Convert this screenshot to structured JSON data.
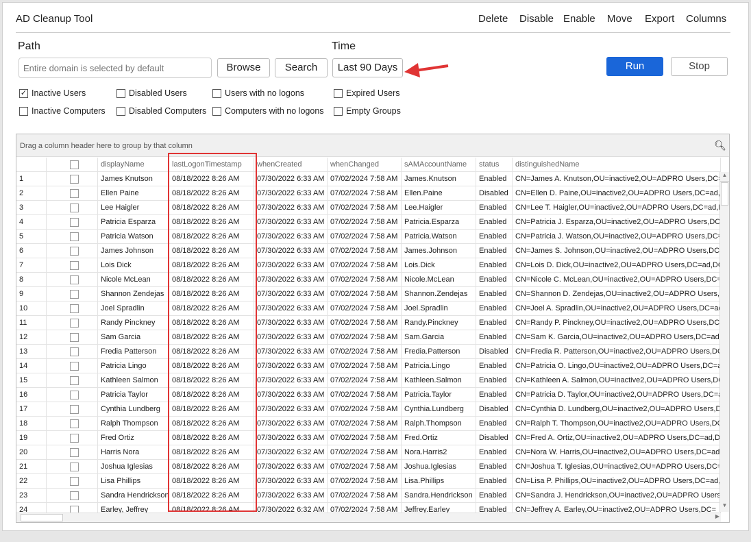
{
  "app": {
    "title": "AD Cleanup Tool"
  },
  "menu": [
    "Delete",
    "Disable",
    "Enable",
    "Move",
    "Export",
    "Columns"
  ],
  "path": {
    "label": "Path",
    "placeholder": "Entire domain is selected by default",
    "browse": "Browse",
    "search": "Search"
  },
  "time": {
    "label": "Time",
    "value": "Last 90 Days"
  },
  "actions": {
    "run": "Run",
    "stop": "Stop"
  },
  "accent": "#1a66d9",
  "highlight_color": "#e03434",
  "filters": [
    {
      "label": "Inactive Users",
      "checked": true
    },
    {
      "label": "Disabled Users",
      "checked": false
    },
    {
      "label": "Users with no logons",
      "checked": false
    },
    {
      "label": "Expired Users",
      "checked": false
    },
    {
      "label": "Inactive Computers",
      "checked": false
    },
    {
      "label": "Disabled Computers",
      "checked": false
    },
    {
      "label": "Computers with no logons",
      "checked": false
    },
    {
      "label": "Empty Groups",
      "checked": false
    }
  ],
  "grid": {
    "group_hint": "Drag a column header here to group by that column",
    "columns": [
      "displayName",
      "lastLogonTimestamp",
      "whenCreated",
      "whenChanged",
      "sAMAccountName",
      "status",
      "distinguishedName"
    ],
    "rows": [
      [
        "James Knutson",
        "08/18/2022 8:26 AM",
        "07/30/2022 6:33 AM",
        "07/02/2024 7:58 AM",
        "James.Knutson",
        "Enabled",
        "CN=James A. Knutson,OU=inactive2,OU=ADPRO Users,DC="
      ],
      [
        "Ellen Paine",
        "08/18/2022 8:26 AM",
        "07/30/2022 6:33 AM",
        "07/02/2024 7:58 AM",
        "Ellen.Paine",
        "Disabled",
        "CN=Ellen D. Paine,OU=inactive2,OU=ADPRO Users,DC=ad,D"
      ],
      [
        "Lee Haigler",
        "08/18/2022 8:26 AM",
        "07/30/2022 6:33 AM",
        "07/02/2024 7:58 AM",
        "Lee.Haigler",
        "Enabled",
        "CN=Lee T. Haigler,OU=inactive2,OU=ADPRO Users,DC=ad,D"
      ],
      [
        "Patricia Esparza",
        "08/18/2022 8:26 AM",
        "07/30/2022 6:33 AM",
        "07/02/2024 7:58 AM",
        "Patricia.Esparza",
        "Enabled",
        "CN=Patricia J. Esparza,OU=inactive2,OU=ADPRO Users,DC="
      ],
      [
        "Patricia Watson",
        "08/18/2022 8:26 AM",
        "07/30/2022 6:33 AM",
        "07/02/2024 7:58 AM",
        "Patricia.Watson",
        "Enabled",
        "CN=Patricia J. Watson,OU=inactive2,OU=ADPRO Users,DC="
      ],
      [
        "James Johnson",
        "08/18/2022 8:26 AM",
        "07/30/2022 6:33 AM",
        "07/02/2024 7:58 AM",
        "James.Johnson",
        "Enabled",
        "CN=James S. Johnson,OU=inactive2,OU=ADPRO Users,DC="
      ],
      [
        "Lois Dick",
        "08/18/2022 8:26 AM",
        "07/30/2022 6:33 AM",
        "07/02/2024 7:58 AM",
        "Lois.Dick",
        "Enabled",
        "CN=Lois D. Dick,OU=inactive2,OU=ADPRO Users,DC=ad,DC"
      ],
      [
        "Nicole McLean",
        "08/18/2022 8:26 AM",
        "07/30/2022 6:33 AM",
        "07/02/2024 7:58 AM",
        "Nicole.McLean",
        "Enabled",
        "CN=Nicole C. McLean,OU=inactive2,OU=ADPRO Users,DC=a"
      ],
      [
        "Shannon Zendejas",
        "08/18/2022 8:26 AM",
        "07/30/2022 6:33 AM",
        "07/02/2024 7:58 AM",
        "Shannon.Zendejas",
        "Enabled",
        "CN=Shannon D. Zendejas,OU=inactive2,OU=ADPRO Users,D"
      ],
      [
        "Joel Spradlin",
        "08/18/2022 8:26 AM",
        "07/30/2022 6:33 AM",
        "07/02/2024 7:58 AM",
        "Joel.Spradlin",
        "Enabled",
        "CN=Joel A. Spradlin,OU=inactive2,OU=ADPRO Users,DC=ad"
      ],
      [
        "Randy Pinckney",
        "08/18/2022 8:26 AM",
        "07/30/2022 6:33 AM",
        "07/02/2024 7:58 AM",
        "Randy.Pinckney",
        "Enabled",
        "CN=Randy P. Pinckney,OU=inactive2,OU=ADPRO Users,DC="
      ],
      [
        "Sam Garcia",
        "08/18/2022 8:26 AM",
        "07/30/2022 6:33 AM",
        "07/02/2024 7:58 AM",
        "Sam.Garcia",
        "Enabled",
        "CN=Sam K. Garcia,OU=inactive2,OU=ADPRO Users,DC=ad,D"
      ],
      [
        "Fredia Patterson",
        "08/18/2022 8:26 AM",
        "07/30/2022 6:33 AM",
        "07/02/2024 7:58 AM",
        "Fredia.Patterson",
        "Disabled",
        "CN=Fredia R. Patterson,OU=inactive2,OU=ADPRO Users,DC"
      ],
      [
        "Patricia Lingo",
        "08/18/2022 8:26 AM",
        "07/30/2022 6:33 AM",
        "07/02/2024 7:58 AM",
        "Patricia.Lingo",
        "Enabled",
        "CN=Patricia O. Lingo,OU=inactive2,OU=ADPRO Users,DC=a"
      ],
      [
        "Kathleen Salmon",
        "08/18/2022 8:26 AM",
        "07/30/2022 6:33 AM",
        "07/02/2024 7:58 AM",
        "Kathleen.Salmon",
        "Enabled",
        "CN=Kathleen A. Salmon,OU=inactive2,OU=ADPRO Users,DC"
      ],
      [
        "Patricia Taylor",
        "08/18/2022 8:26 AM",
        "07/30/2022 6:33 AM",
        "07/02/2024 7:58 AM",
        "Patricia.Taylor",
        "Enabled",
        "CN=Patricia D. Taylor,OU=inactive2,OU=ADPRO Users,DC=a"
      ],
      [
        "Cynthia Lundberg",
        "08/18/2022 8:26 AM",
        "07/30/2022 6:33 AM",
        "07/02/2024 7:58 AM",
        "Cynthia.Lundberg",
        "Disabled",
        "CN=Cynthia D. Lundberg,OU=inactive2,OU=ADPRO Users,D"
      ],
      [
        "Ralph Thompson",
        "08/18/2022 8:26 AM",
        "07/30/2022 6:33 AM",
        "07/02/2024 7:58 AM",
        "Ralph.Thompson",
        "Enabled",
        "CN=Ralph T. Thompson,OU=inactive2,OU=ADPRO Users,DC"
      ],
      [
        "Fred Ortiz",
        "08/18/2022 8:26 AM",
        "07/30/2022 6:33 AM",
        "07/02/2024 7:58 AM",
        "Fred.Ortiz",
        "Disabled",
        "CN=Fred A. Ortiz,OU=inactive2,OU=ADPRO Users,DC=ad,D"
      ],
      [
        "Harris Nora",
        "08/18/2022 8:26 AM",
        "07/30/2022 6:32 AM",
        "07/02/2024 7:58 AM",
        "Nora.Harris2",
        "Enabled",
        "CN=Nora W. Harris,OU=inactive2,OU=ADPRO Users,DC=ad,"
      ],
      [
        "Joshua Iglesias",
        "08/18/2022 8:26 AM",
        "07/30/2022 6:33 AM",
        "07/02/2024 7:58 AM",
        "Joshua.Iglesias",
        "Enabled",
        "CN=Joshua T. Iglesias,OU=inactive2,OU=ADPRO Users,DC="
      ],
      [
        "Lisa Phillips",
        "08/18/2022 8:26 AM",
        "07/30/2022 6:33 AM",
        "07/02/2024 7:58 AM",
        "Lisa.Phillips",
        "Enabled",
        "CN=Lisa P. Phillips,OU=inactive2,OU=ADPRO Users,DC=ad,D"
      ],
      [
        "Sandra Hendrickson",
        "08/18/2022 8:26 AM",
        "07/30/2022 6:33 AM",
        "07/02/2024 7:58 AM",
        "Sandra.Hendrickson",
        "Enabled",
        "CN=Sandra J. Hendrickson,OU=inactive2,OU=ADPRO Users,"
      ],
      [
        "Earley, Jeffrey",
        "08/18/2022 8:26 AM",
        "07/30/2022 6:32 AM",
        "07/02/2024 7:58 AM",
        "Jeffrey.Earley",
        "Enabled",
        "CN=Jeffrey A. Earley,OU=inactive2,OU=ADPRO Users,DC="
      ]
    ]
  }
}
